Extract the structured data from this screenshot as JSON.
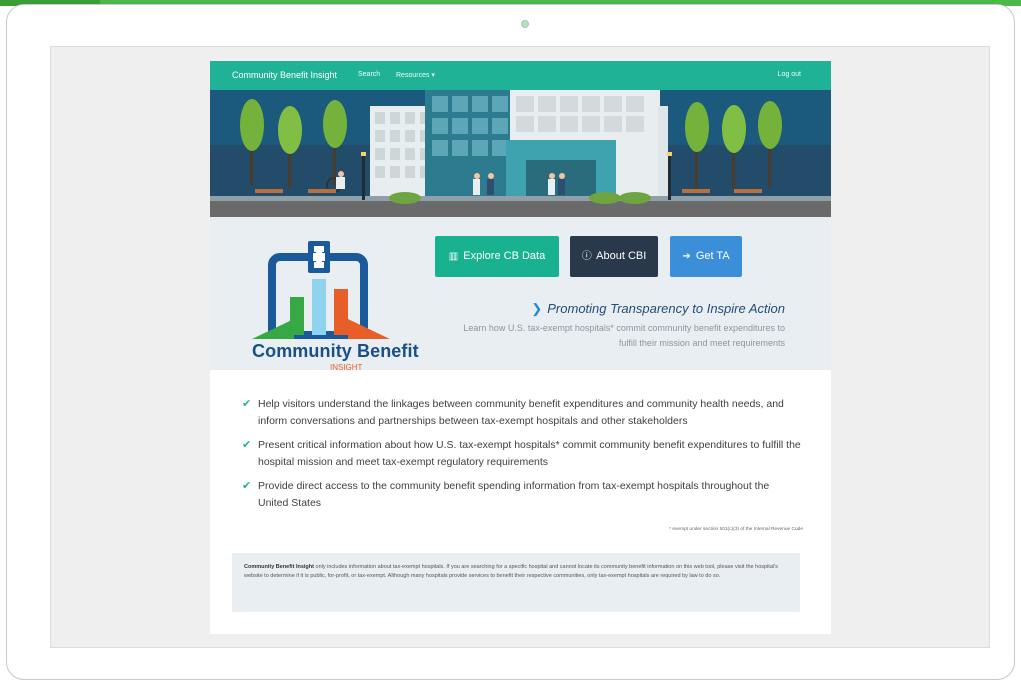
{
  "navbar": {
    "brand": "Community Benefit Insight",
    "search_label": "Search",
    "resources_label": "Resources ▾",
    "logout_label": "Log out"
  },
  "logo": {
    "title": "Community Benefit",
    "subtitle": "INSIGHT"
  },
  "actions": {
    "explore_label": "Explore CB Data",
    "about_label": "About CBI",
    "ta_label": "Get TA"
  },
  "promo": {
    "heading": "Promoting Transparency to Inspire Action",
    "text": "Learn how U.S. tax-exempt hospitals* commit community benefit expenditures to fulfill their mission and meet requirements"
  },
  "bullets": [
    "Help visitors understand the linkages between community benefit expenditures and community health needs, and inform conversations and partnerships between tax-exempt hospitals and other stakeholders",
    "Present critical information about how U.S. tax-exempt hospitals* commit community benefit expenditures to fulfill the hospital mission and meet tax-exempt regulatory requirements",
    "Provide direct access to the community benefit spending information from tax-exempt hospitals throughout the United States"
  ],
  "footnote": "* exempt under section 501(c)(3) of the Internal Revenue Code",
  "notice": {
    "bold": "Community Benefit Insight",
    "text": " only includes information about tax-exempt hospitals. If you are searching for a specific hospital and cannot locate its community benefit information on this web tool, please visit the hospital's website to determine if it is public, for-profit, or tax-exempt. Although many hospitals provide services to benefit their respective communities, only tax-exempt hospitals are required by law to do so."
  },
  "colors": {
    "accent": "#1fb296",
    "navy": "#29384a",
    "blue": "#3b8fd9",
    "device_top": "#4cb849"
  },
  "icons": {
    "explore": "bar-chart-icon",
    "about": "info-circle-icon",
    "ta": "arrow-right-icon",
    "bullet": "check-icon"
  }
}
